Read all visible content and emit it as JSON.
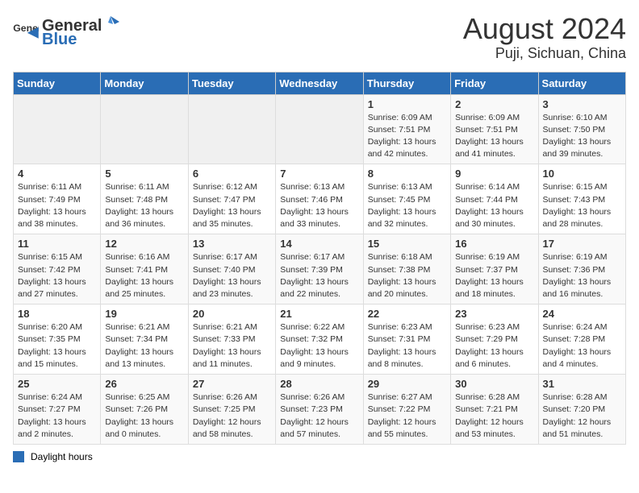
{
  "header": {
    "logo_general": "General",
    "logo_blue": "Blue",
    "title": "August 2024",
    "subtitle": "Puji, Sichuan, China"
  },
  "calendar": {
    "days_of_week": [
      "Sunday",
      "Monday",
      "Tuesday",
      "Wednesday",
      "Thursday",
      "Friday",
      "Saturday"
    ],
    "weeks": [
      [
        {
          "day": "",
          "info": ""
        },
        {
          "day": "",
          "info": ""
        },
        {
          "day": "",
          "info": ""
        },
        {
          "day": "",
          "info": ""
        },
        {
          "day": "1",
          "info": "Sunrise: 6:09 AM\nSunset: 7:51 PM\nDaylight: 13 hours\nand 42 minutes."
        },
        {
          "day": "2",
          "info": "Sunrise: 6:09 AM\nSunset: 7:51 PM\nDaylight: 13 hours\nand 41 minutes."
        },
        {
          "day": "3",
          "info": "Sunrise: 6:10 AM\nSunset: 7:50 PM\nDaylight: 13 hours\nand 39 minutes."
        }
      ],
      [
        {
          "day": "4",
          "info": "Sunrise: 6:11 AM\nSunset: 7:49 PM\nDaylight: 13 hours\nand 38 minutes."
        },
        {
          "day": "5",
          "info": "Sunrise: 6:11 AM\nSunset: 7:48 PM\nDaylight: 13 hours\nand 36 minutes."
        },
        {
          "day": "6",
          "info": "Sunrise: 6:12 AM\nSunset: 7:47 PM\nDaylight: 13 hours\nand 35 minutes."
        },
        {
          "day": "7",
          "info": "Sunrise: 6:13 AM\nSunset: 7:46 PM\nDaylight: 13 hours\nand 33 minutes."
        },
        {
          "day": "8",
          "info": "Sunrise: 6:13 AM\nSunset: 7:45 PM\nDaylight: 13 hours\nand 32 minutes."
        },
        {
          "day": "9",
          "info": "Sunrise: 6:14 AM\nSunset: 7:44 PM\nDaylight: 13 hours\nand 30 minutes."
        },
        {
          "day": "10",
          "info": "Sunrise: 6:15 AM\nSunset: 7:43 PM\nDaylight: 13 hours\nand 28 minutes."
        }
      ],
      [
        {
          "day": "11",
          "info": "Sunrise: 6:15 AM\nSunset: 7:42 PM\nDaylight: 13 hours\nand 27 minutes."
        },
        {
          "day": "12",
          "info": "Sunrise: 6:16 AM\nSunset: 7:41 PM\nDaylight: 13 hours\nand 25 minutes."
        },
        {
          "day": "13",
          "info": "Sunrise: 6:17 AM\nSunset: 7:40 PM\nDaylight: 13 hours\nand 23 minutes."
        },
        {
          "day": "14",
          "info": "Sunrise: 6:17 AM\nSunset: 7:39 PM\nDaylight: 13 hours\nand 22 minutes."
        },
        {
          "day": "15",
          "info": "Sunrise: 6:18 AM\nSunset: 7:38 PM\nDaylight: 13 hours\nand 20 minutes."
        },
        {
          "day": "16",
          "info": "Sunrise: 6:19 AM\nSunset: 7:37 PM\nDaylight: 13 hours\nand 18 minutes."
        },
        {
          "day": "17",
          "info": "Sunrise: 6:19 AM\nSunset: 7:36 PM\nDaylight: 13 hours\nand 16 minutes."
        }
      ],
      [
        {
          "day": "18",
          "info": "Sunrise: 6:20 AM\nSunset: 7:35 PM\nDaylight: 13 hours\nand 15 minutes."
        },
        {
          "day": "19",
          "info": "Sunrise: 6:21 AM\nSunset: 7:34 PM\nDaylight: 13 hours\nand 13 minutes."
        },
        {
          "day": "20",
          "info": "Sunrise: 6:21 AM\nSunset: 7:33 PM\nDaylight: 13 hours\nand 11 minutes."
        },
        {
          "day": "21",
          "info": "Sunrise: 6:22 AM\nSunset: 7:32 PM\nDaylight: 13 hours\nand 9 minutes."
        },
        {
          "day": "22",
          "info": "Sunrise: 6:23 AM\nSunset: 7:31 PM\nDaylight: 13 hours\nand 8 minutes."
        },
        {
          "day": "23",
          "info": "Sunrise: 6:23 AM\nSunset: 7:29 PM\nDaylight: 13 hours\nand 6 minutes."
        },
        {
          "day": "24",
          "info": "Sunrise: 6:24 AM\nSunset: 7:28 PM\nDaylight: 13 hours\nand 4 minutes."
        }
      ],
      [
        {
          "day": "25",
          "info": "Sunrise: 6:24 AM\nSunset: 7:27 PM\nDaylight: 13 hours\nand 2 minutes."
        },
        {
          "day": "26",
          "info": "Sunrise: 6:25 AM\nSunset: 7:26 PM\nDaylight: 13 hours\nand 0 minutes."
        },
        {
          "day": "27",
          "info": "Sunrise: 6:26 AM\nSunset: 7:25 PM\nDaylight: 12 hours\nand 58 minutes."
        },
        {
          "day": "28",
          "info": "Sunrise: 6:26 AM\nSunset: 7:23 PM\nDaylight: 12 hours\nand 57 minutes."
        },
        {
          "day": "29",
          "info": "Sunrise: 6:27 AM\nSunset: 7:22 PM\nDaylight: 12 hours\nand 55 minutes."
        },
        {
          "day": "30",
          "info": "Sunrise: 6:28 AM\nSunset: 7:21 PM\nDaylight: 12 hours\nand 53 minutes."
        },
        {
          "day": "31",
          "info": "Sunrise: 6:28 AM\nSunset: 7:20 PM\nDaylight: 12 hours\nand 51 minutes."
        }
      ]
    ]
  },
  "legend": {
    "label": "Daylight hours"
  }
}
